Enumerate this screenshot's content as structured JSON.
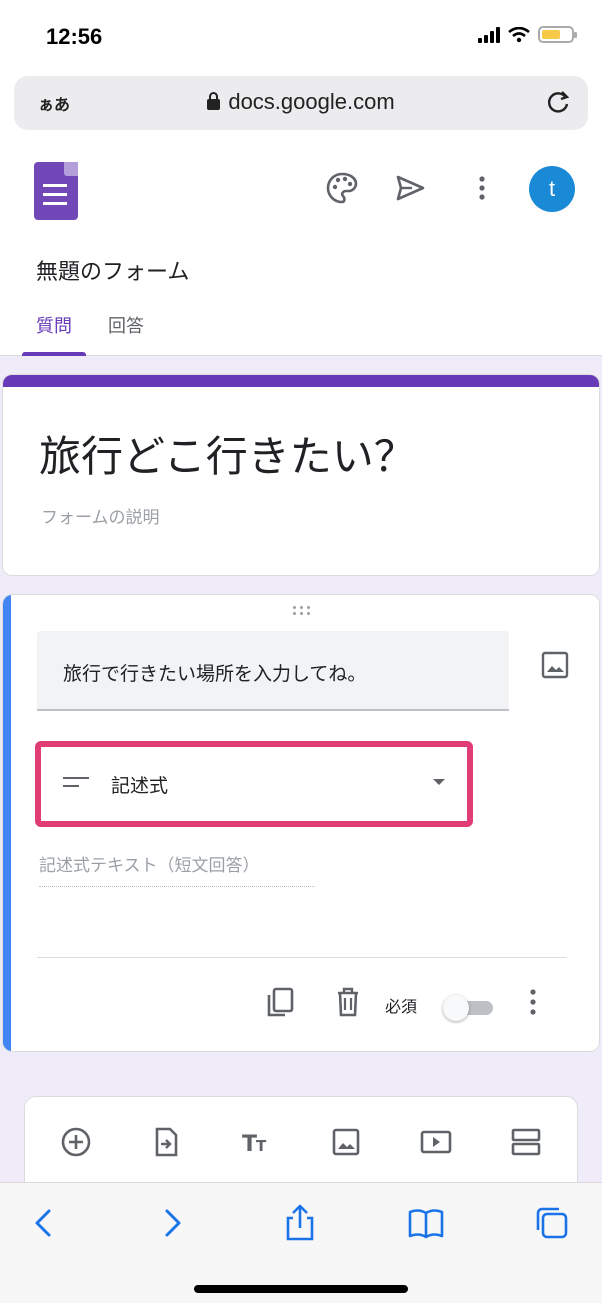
{
  "status_bar": {
    "time": "12:56"
  },
  "browser": {
    "text_size_label": "ぁあ",
    "url": "docs.google.com"
  },
  "header": {
    "form_name": "無題のフォーム",
    "avatar_initial": "t",
    "tabs": [
      {
        "label": "質問",
        "active": true
      },
      {
        "label": "回答",
        "active": false
      }
    ]
  },
  "title_card": {
    "title": "旅行どこ行きたい？",
    "description_placeholder": "フォームの説明"
  },
  "question_card": {
    "question_text": "旅行で行きたい場所を入力してね。",
    "type_label": "記述式",
    "answer_placeholder": "記述式テキスト（短文回答）",
    "required_label": "必須",
    "required_on": false
  },
  "colors": {
    "accent_purple": "#673ab7",
    "question_accent": "#4285f4",
    "highlight_box": "#e23c77",
    "avatar": "#1a8ad7"
  }
}
